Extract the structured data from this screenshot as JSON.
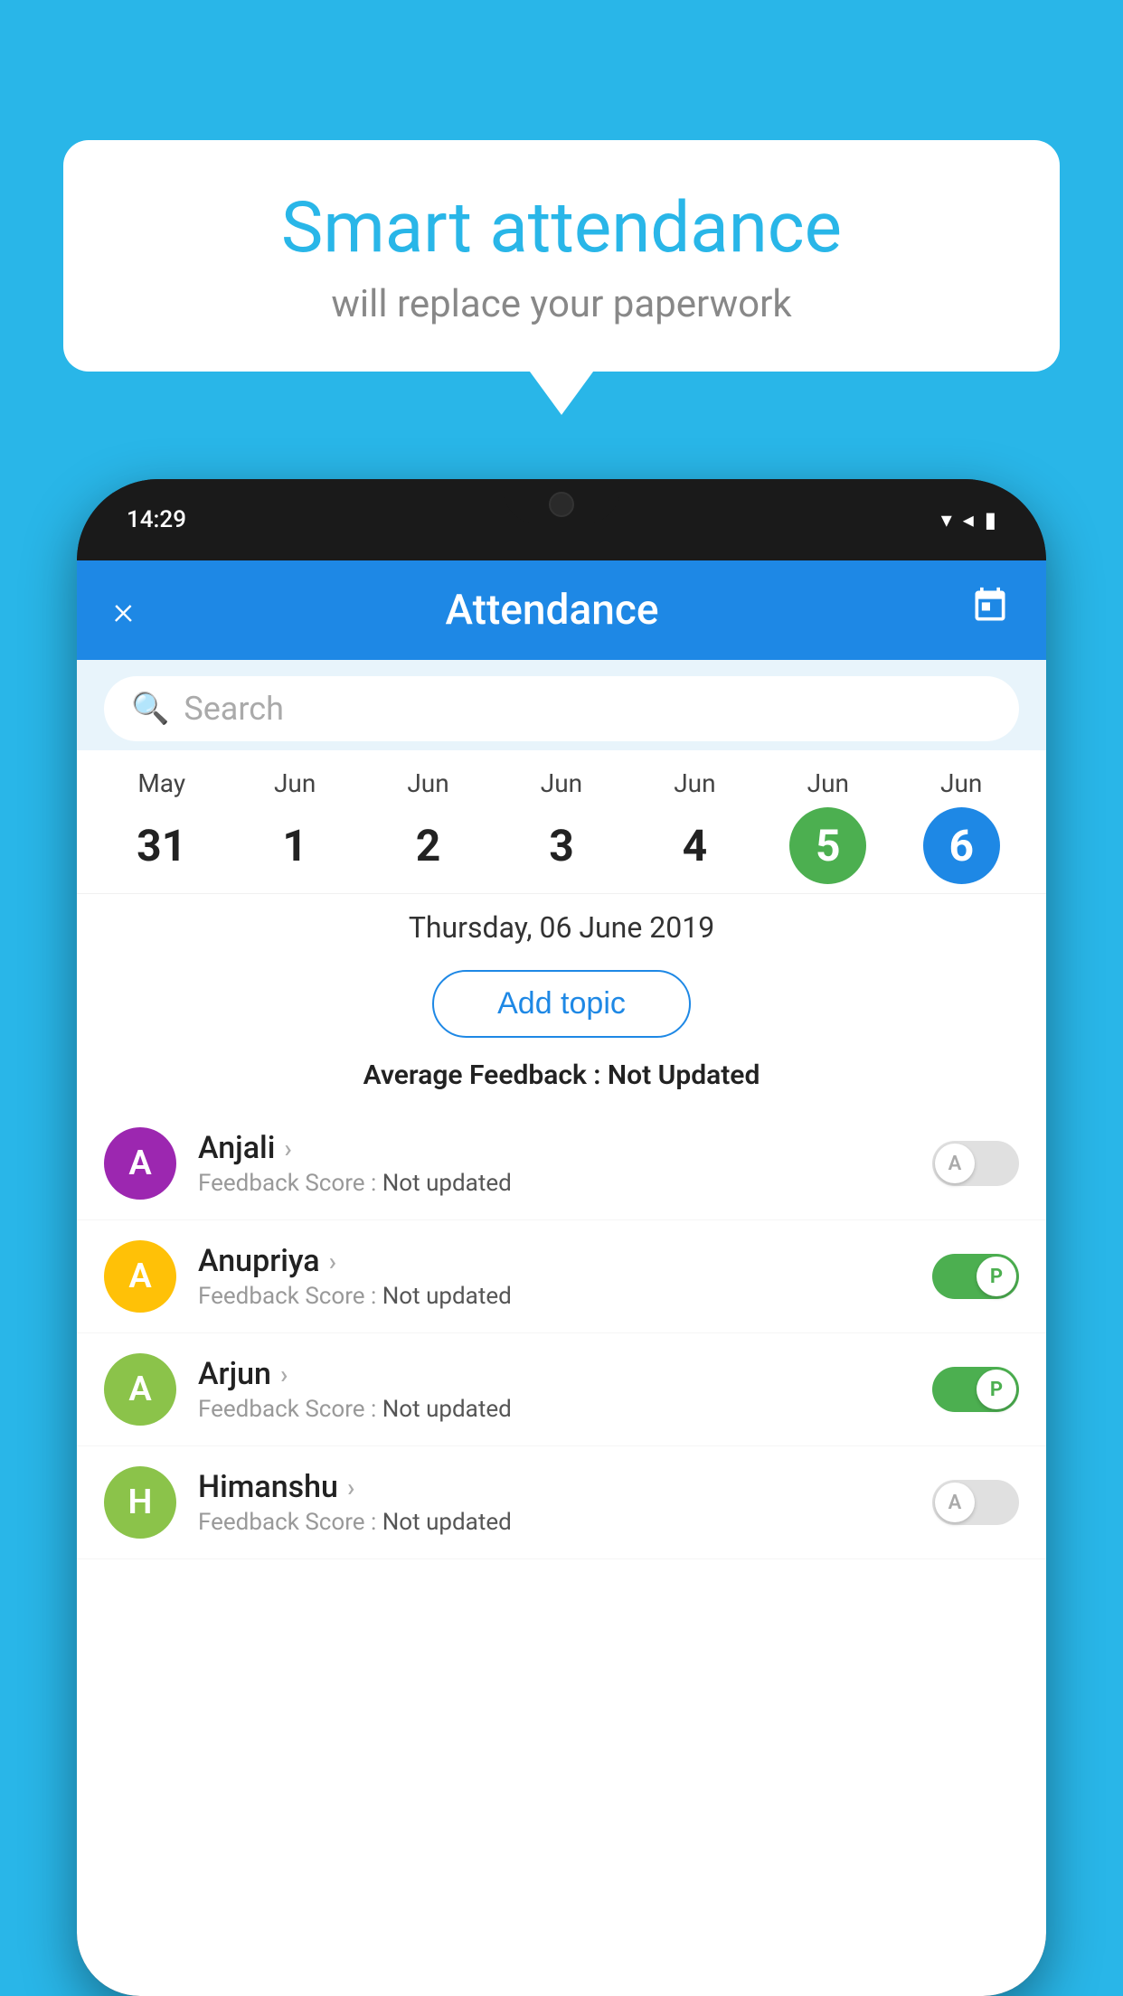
{
  "background": {
    "color": "#29b6e8"
  },
  "speech_bubble": {
    "title": "Smart attendance",
    "subtitle": "will replace your paperwork"
  },
  "phone": {
    "status_bar": {
      "time": "14:29",
      "wifi_icon": "▼",
      "signal_icon": "▲",
      "battery_icon": "▮"
    },
    "header": {
      "close_label": "×",
      "title": "Attendance",
      "calendar_icon": "📅"
    },
    "search": {
      "placeholder": "Search"
    },
    "calendar": {
      "dates": [
        {
          "month": "May",
          "day": "31",
          "style": "normal"
        },
        {
          "month": "Jun",
          "day": "1",
          "style": "normal"
        },
        {
          "month": "Jun",
          "day": "2",
          "style": "normal"
        },
        {
          "month": "Jun",
          "day": "3",
          "style": "normal"
        },
        {
          "month": "Jun",
          "day": "4",
          "style": "normal"
        },
        {
          "month": "Jun",
          "day": "5",
          "style": "today"
        },
        {
          "month": "Jun",
          "day": "6",
          "style": "selected"
        }
      ]
    },
    "selected_date": "Thursday, 06 June 2019",
    "add_topic_label": "Add topic",
    "avg_feedback_label": "Average Feedback :",
    "avg_feedback_value": "Not Updated",
    "students": [
      {
        "name": "Anjali",
        "avatar_letter": "A",
        "avatar_color": "#9c27b0",
        "feedback_label": "Feedback Score :",
        "feedback_value": "Not updated",
        "toggle": "off",
        "toggle_letter": "A"
      },
      {
        "name": "Anupriya",
        "avatar_letter": "A",
        "avatar_color": "#ffc107",
        "feedback_label": "Feedback Score :",
        "feedback_value": "Not updated",
        "toggle": "on",
        "toggle_letter": "P"
      },
      {
        "name": "Arjun",
        "avatar_letter": "A",
        "avatar_color": "#8bc34a",
        "feedback_label": "Feedback Score :",
        "feedback_value": "Not updated",
        "toggle": "on",
        "toggle_letter": "P"
      },
      {
        "name": "Himanshu",
        "avatar_letter": "H",
        "avatar_color": "#8bc34a",
        "feedback_label": "Feedback Score :",
        "feedback_value": "Not updated",
        "toggle": "off",
        "toggle_letter": "A"
      }
    ]
  }
}
